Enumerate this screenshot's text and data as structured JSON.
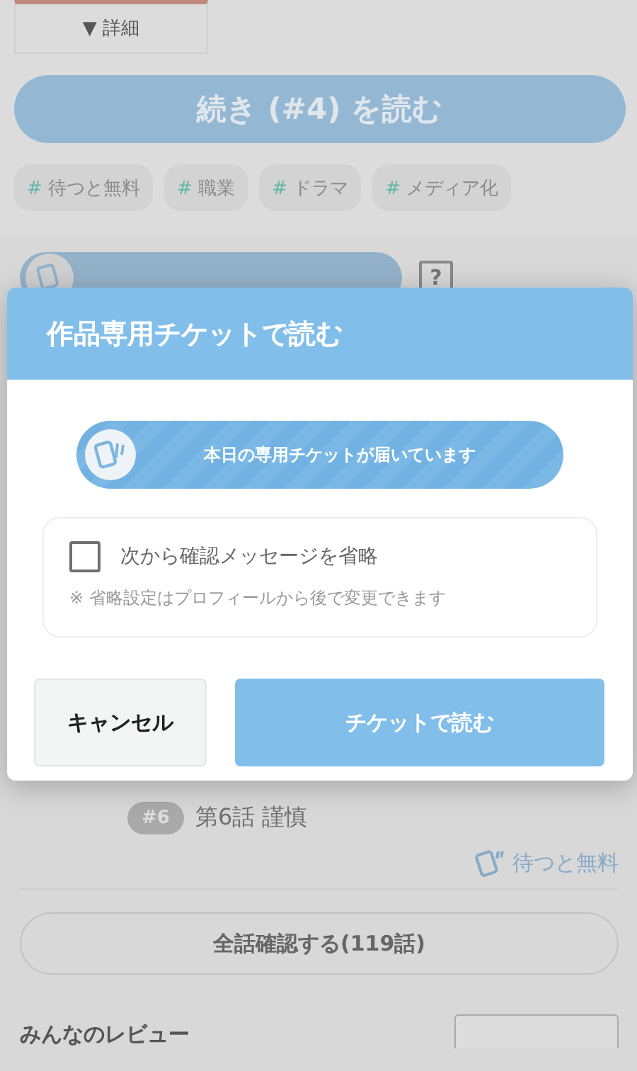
{
  "page": {
    "details_toggle": "▼ 詳細",
    "continue_button": "続き (#4) を読む",
    "tags": [
      {
        "hash": "#",
        "label": "待つと無料"
      },
      {
        "hash": "#",
        "label": "職業"
      },
      {
        "hash": "#",
        "label": "ドラマ"
      },
      {
        "hash": "#",
        "label": "メディア化"
      }
    ],
    "help_mark": "?"
  },
  "episodes": [
    {
      "badge": "#6",
      "title": "第6話 謹慎",
      "status": "待つと無料"
    }
  ],
  "all_episodes_button": "全話確認する(119話)",
  "reviews": {
    "title": "みんなのレビュー"
  },
  "dialog": {
    "title": "作品専用チケットで読む",
    "ticket_banner": "本日の専用チケットが届いています",
    "skip_confirm": {
      "label": "次から確認メッセージを省略",
      "checked": false
    },
    "note": "※ 省略設定はプロフィールから後で変更できます",
    "buttons": [
      {
        "label": "キャンセル",
        "kind": "secondary"
      },
      {
        "label": "チケットで読む",
        "kind": "primary"
      }
    ]
  }
}
